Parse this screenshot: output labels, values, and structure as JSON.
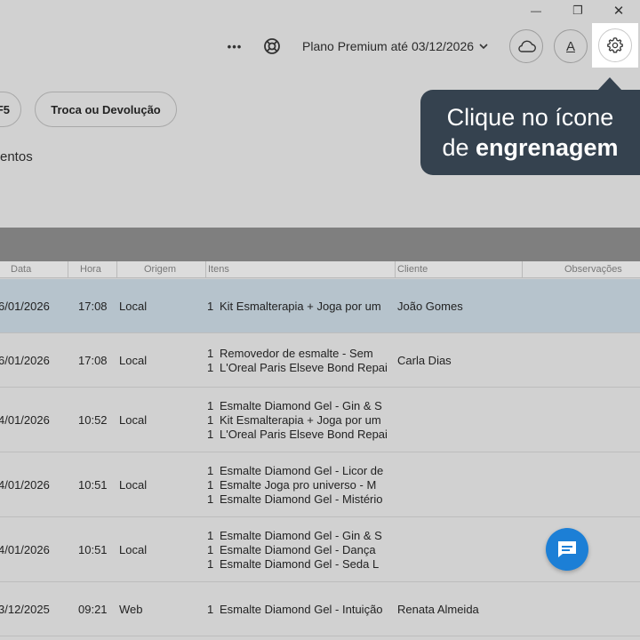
{
  "window": {
    "minimize": "—",
    "restore": "❐",
    "close": "✕"
  },
  "header": {
    "more_label": "•••",
    "plan_label": "Plano Premium até 03/12/2026",
    "font_button_label": "A"
  },
  "actions": {
    "pill_partial": "F5",
    "pill_return": "Troca ou Devolução"
  },
  "tooltip": {
    "line1": "Clique no ícone",
    "line2_prefix": "de",
    "line2_bold": "engrenagem"
  },
  "section": {
    "label_partial": "entos"
  },
  "table": {
    "columns": [
      "Data",
      "Hora",
      "Origem",
      "Itens",
      "Cliente",
      "Observações"
    ],
    "rows": [
      {
        "date": "6/01/2026",
        "time": "17:08",
        "origin": "Local",
        "client": "João Gomes",
        "selected": true,
        "items": [
          {
            "qty": "1",
            "name": "Kit Esmalterapia + Joga por um"
          }
        ]
      },
      {
        "date": "6/01/2026",
        "time": "17:08",
        "origin": "Local",
        "client": "Carla Dias",
        "selected": false,
        "items": [
          {
            "qty": "1",
            "name": "Removedor de esmalte - Sem"
          },
          {
            "qty": "1",
            "name": "L'Oreal Paris Elseve Bond Repair"
          }
        ]
      },
      {
        "date": "4/01/2026",
        "time": "10:52",
        "origin": "Local",
        "client": "",
        "selected": false,
        "items": [
          {
            "qty": "1",
            "name": "Esmalte Diamond Gel - Gin & S"
          },
          {
            "qty": "1",
            "name": "Kit Esmalterapia + Joga por um"
          },
          {
            "qty": "1",
            "name": "L'Oreal Paris Elseve Bond Repair"
          }
        ]
      },
      {
        "date": "4/01/2026",
        "time": "10:51",
        "origin": "Local",
        "client": "",
        "selected": false,
        "items": [
          {
            "qty": "1",
            "name": "Esmalte Diamond Gel - Licor de"
          },
          {
            "qty": "1",
            "name": "Esmalte Joga pro universo - M"
          },
          {
            "qty": "1",
            "name": "Esmalte Diamond Gel - Mistério"
          }
        ]
      },
      {
        "date": "4/01/2026",
        "time": "10:51",
        "origin": "Local",
        "client": "",
        "selected": false,
        "items": [
          {
            "qty": "1",
            "name": "Esmalte Diamond Gel - Gin & S"
          },
          {
            "qty": "1",
            "name": "Esmalte Diamond Gel - Dança"
          },
          {
            "qty": "1",
            "name": "Esmalte Diamond Gel - Seda L"
          }
        ]
      },
      {
        "date": "3/12/2025",
        "time": "09:21",
        "origin": "Web",
        "client": "Renata Almeida",
        "selected": false,
        "items": [
          {
            "qty": "1",
            "name": "Esmalte Diamond Gel - Intuição"
          }
        ]
      }
    ]
  },
  "colors": {
    "tooltip_bg": "#35424f",
    "selected_row": "#b6c3cc",
    "chat_button": "#1c7fd6",
    "overlay_gray": "#d1d1d1"
  },
  "icons": {
    "help": "lifebuoy-icon",
    "cloud": "cloud-icon",
    "settings": "gear-icon",
    "chat": "chat-bubble-icon"
  }
}
